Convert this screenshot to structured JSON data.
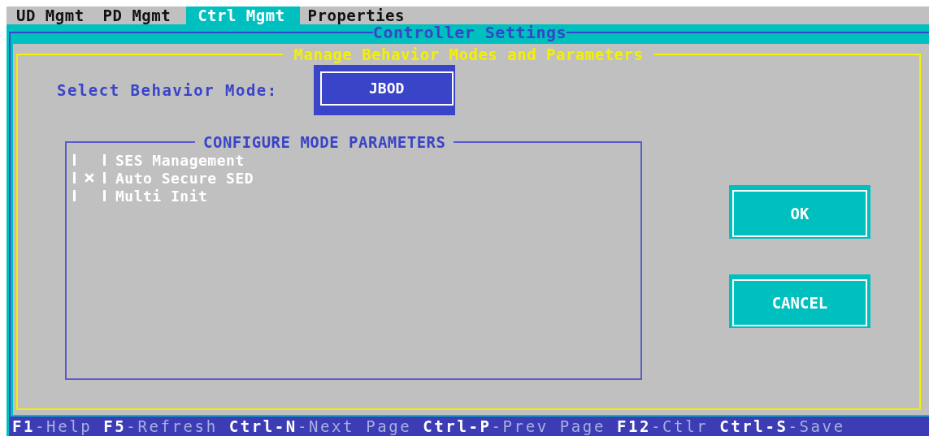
{
  "menu_tabs": [
    {
      "label": "UD Mgmt",
      "selected": false
    },
    {
      "label": "PD Mgmt",
      "selected": false
    },
    {
      "label": "Ctrl Mgmt",
      "selected": true
    },
    {
      "label": "Properties",
      "selected": false
    }
  ],
  "window": {
    "title": "Controller Settings"
  },
  "panel": {
    "title": "Manage Behavior Modes and Parameters",
    "mode_label": "Select Behavior Mode:",
    "mode_value": "JBOD",
    "parameters": {
      "title": "CONFIGURE MODE PARAMETERS",
      "items": [
        {
          "label": "SES Management",
          "checked": false
        },
        {
          "label": "Auto Secure SED",
          "checked": true
        },
        {
          "label": "Multi Init",
          "checked": false
        }
      ]
    },
    "buttons": [
      "OK",
      "CANCEL"
    ]
  },
  "status_bar": [
    {
      "key": "F1",
      "label": "-Help"
    },
    {
      "key": "F5",
      "label": "-Refresh"
    },
    {
      "key": "Ctrl-N",
      "label": "-Next Page"
    },
    {
      "key": "Ctrl-P",
      "label": "-Prev Page"
    },
    {
      "key": "F12",
      "label": "-Ctlr"
    },
    {
      "key": "Ctrl-S",
      "label": "-Save"
    }
  ]
}
